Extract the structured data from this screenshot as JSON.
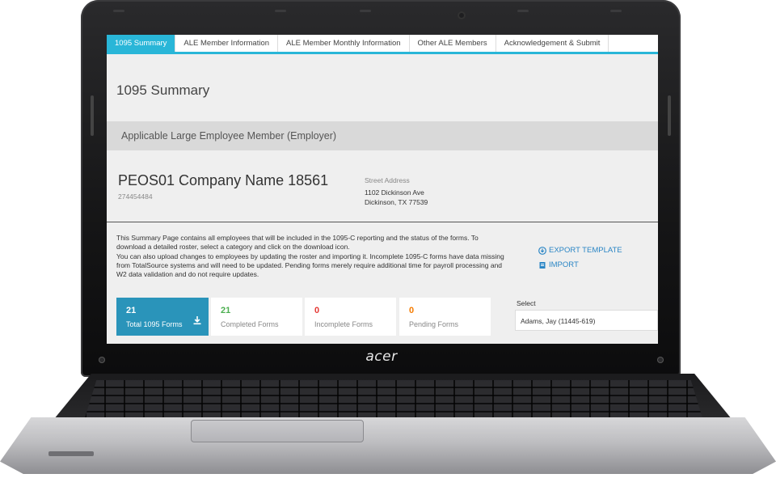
{
  "device": {
    "brand": "acer"
  },
  "tabs": [
    {
      "label": "1095 Summary",
      "active": true
    },
    {
      "label": "ALE Member Information",
      "active": false
    },
    {
      "label": "ALE Member Monthly Information",
      "active": false
    },
    {
      "label": "Other ALE Members",
      "active": false
    },
    {
      "label": "Acknowledgement & Submit",
      "active": false
    }
  ],
  "page": {
    "title": "1095 Summary"
  },
  "section": {
    "title": "Applicable Large Employee Member (Employer)"
  },
  "company": {
    "name": "PEOS01 Company Name 18561",
    "id": "274454484",
    "address_label": "Street Address",
    "address_line1": "1102 Dickinson Ave",
    "address_line2": "Dickinson, TX 77539"
  },
  "info": {
    "paragraph1": "This Summary Page contains all employees that will be included in the 1095-C reporting and the status of the forms. To download a detailed roster, select a category and click on the download icon.",
    "paragraph2": "You can also upload changes to employees by updating the roster and importing it. Incomplete 1095-C forms have data missing from TotalSource systems and will need to be updated. Pending forms merely require additional time for payroll processing and W2 data validation and do not require updates."
  },
  "actions": {
    "export_label": "EXPORT TEMPLATE",
    "import_label": "IMPORT"
  },
  "stats": [
    {
      "value": "21",
      "label": "Total 1095 Forms",
      "color": "#ffffff"
    },
    {
      "value": "21",
      "label": "Completed Forms",
      "color": "#4caf50"
    },
    {
      "value": "0",
      "label": "Incomplete Forms",
      "color": "#e53935"
    },
    {
      "value": "0",
      "label": "Pending Forms",
      "color": "#f57c00"
    }
  ],
  "employee_select": {
    "label": "Select",
    "value": "Adams, Jay (11445-619)"
  },
  "colors": {
    "accent": "#29b6d8",
    "active_card": "#2a94ba",
    "link": "#2b86c5"
  }
}
